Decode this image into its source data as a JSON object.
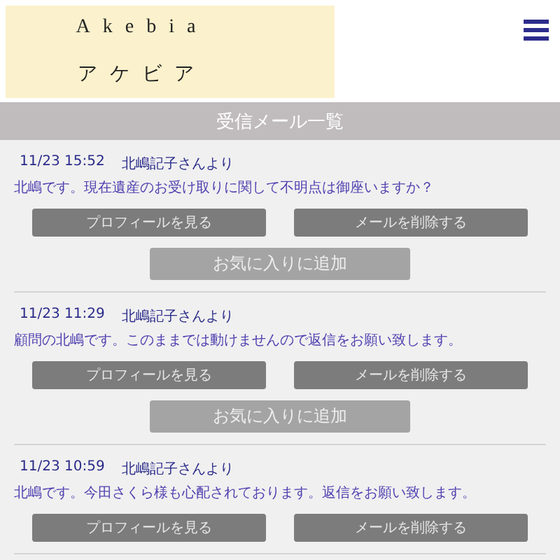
{
  "logo": {
    "latin": "Akebia",
    "kana": "アケビア"
  },
  "title": "受信メール一覧",
  "messages": [
    {
      "date": "11/23 15:52",
      "sender": "北嶋記子さんより",
      "body": "北嶋です。現在遺産のお受け取りに関して不明点は御座いますか？",
      "profile_button": "プロフィールを見る",
      "delete_button": "メールを削除する",
      "favorite_button": "お気に入りに追加"
    },
    {
      "date": "11/23 11:29",
      "sender": "北嶋記子さんより",
      "body": "顧問の北嶋です。このままでは動けませんので返信をお願い致します。",
      "profile_button": "プロフィールを見る",
      "delete_button": "メールを削除する",
      "favorite_button": "お気に入りに追加"
    },
    {
      "date": "11/23 10:59",
      "sender": "北嶋記子さんより",
      "body": "北嶋です。今田さくら様も心配されております。返信をお願い致します。",
      "profile_button": "プロフィールを見る",
      "delete_button": "メールを削除する"
    }
  ]
}
